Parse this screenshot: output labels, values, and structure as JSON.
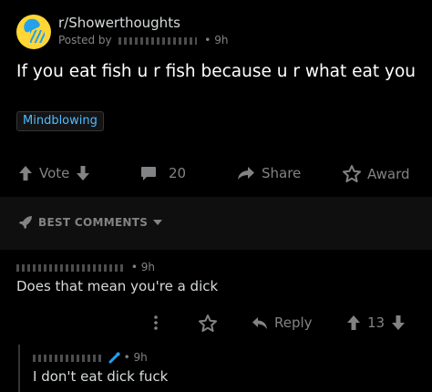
{
  "post": {
    "subreddit": "r/Showerthoughts",
    "posted_by_prefix": "Posted by",
    "posted_age": "• 9h",
    "title": "If you eat fish u r fish because u r what eat you",
    "flair": "Mindblowing"
  },
  "actions": {
    "vote_label": "Vote",
    "comments_count": "20",
    "share_label": "Share",
    "award_label": "Award"
  },
  "comments_section": {
    "sort_label": "BEST COMMENTS"
  },
  "comments": [
    {
      "age": "• 9h",
      "body": "Does that mean you're a dick",
      "reply_label": "Reply",
      "score": "13"
    },
    {
      "age": "• 9h",
      "body": "I don't eat dick fuck"
    }
  ],
  "colors": {
    "background": "#000000",
    "text": "#d7dadc",
    "muted": "#818384",
    "flair_text": "#4fbcff",
    "band": "#0f0f10"
  }
}
